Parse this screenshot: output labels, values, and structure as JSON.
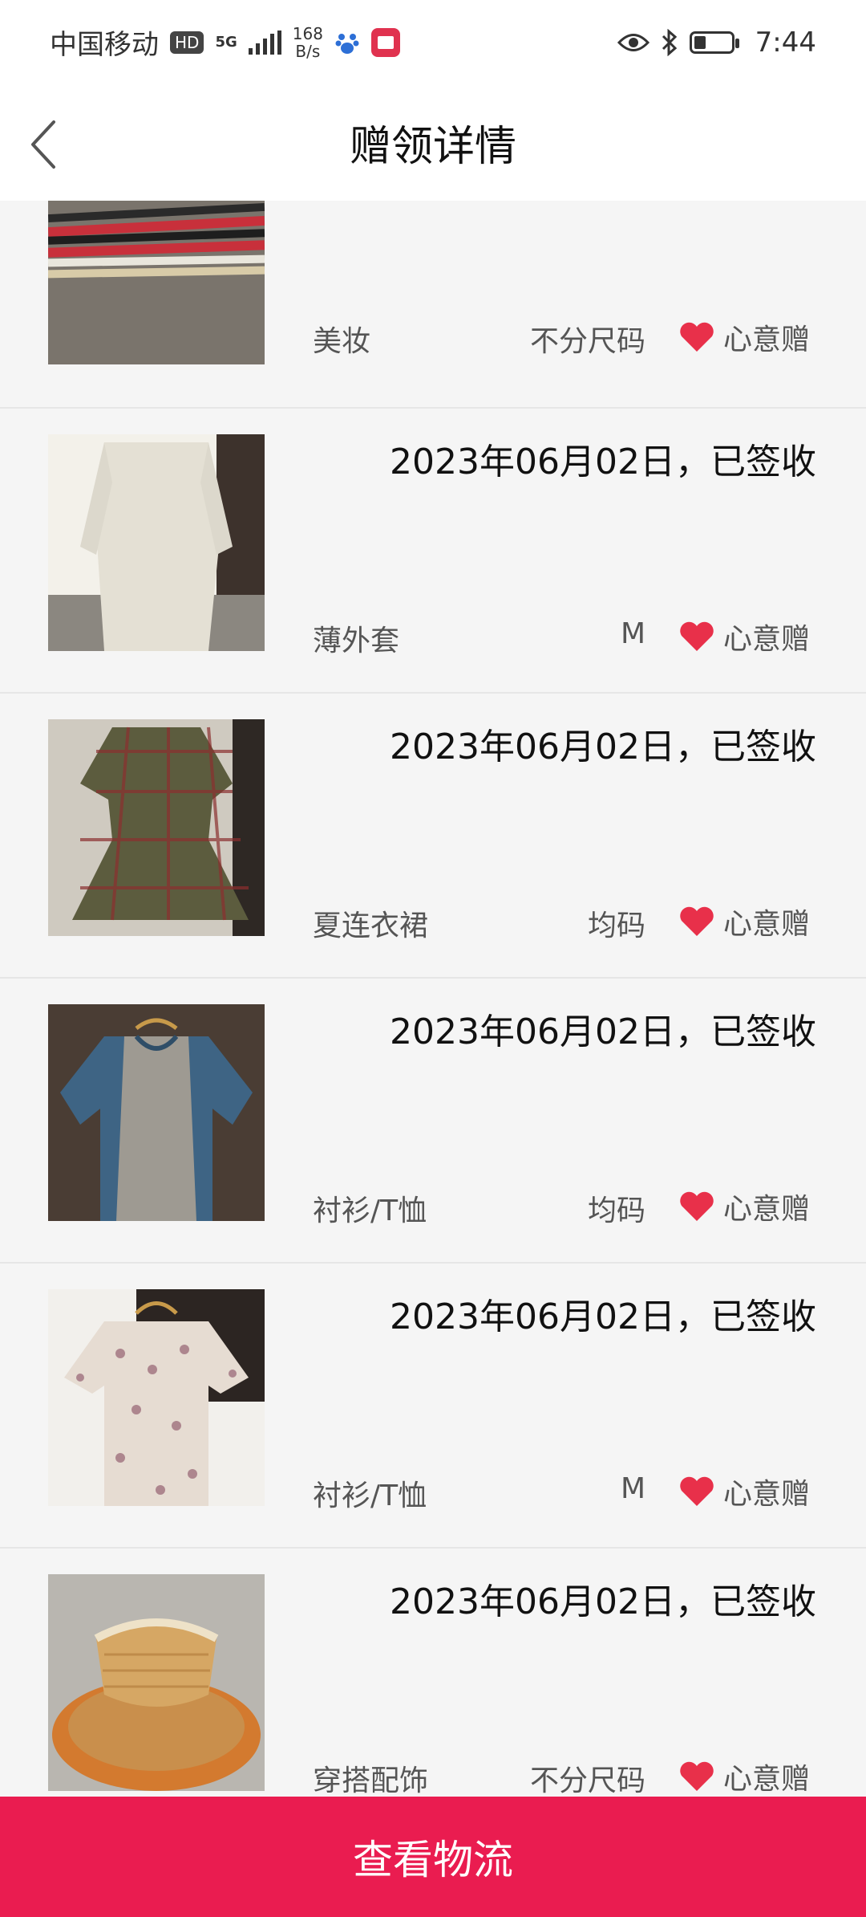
{
  "status_bar": {
    "carrier": "中国移动",
    "hd": "HD",
    "network": "5G",
    "speed_value": "168",
    "speed_unit": "B/s",
    "time": "7:44"
  },
  "header": {
    "title": "赠领详情"
  },
  "items": [
    {
      "date": "",
      "category": "美妆",
      "size": "不分尺码",
      "gift_label": "心意赠",
      "thumb": "pens"
    },
    {
      "date": "2023年06月02日，已签收",
      "category": "薄外套",
      "size": "M",
      "gift_label": "心意赠",
      "thumb": "white-coat"
    },
    {
      "date": "2023年06月02日，已签收",
      "category": "夏连衣裙",
      "size": "均码",
      "gift_label": "心意赠",
      "thumb": "plaid-dress"
    },
    {
      "date": "2023年06月02日，已签收",
      "category": "衬衫/T恤",
      "size": "均码",
      "gift_label": "心意赠",
      "thumb": "grey-blue-tee"
    },
    {
      "date": "2023年06月02日，已签收",
      "category": "衬衫/T恤",
      "size": "M",
      "gift_label": "心意赠",
      "thumb": "floral-blouse"
    },
    {
      "date": "2023年06月02日，已签收",
      "category": "穿搭配饰",
      "size": "不分尺码",
      "gift_label": "心意赠",
      "thumb": "straw-visor"
    }
  ],
  "footer": {
    "button_label": "查看物流"
  },
  "colors": {
    "accent": "#ea1c50",
    "heart": "#e8304a"
  }
}
